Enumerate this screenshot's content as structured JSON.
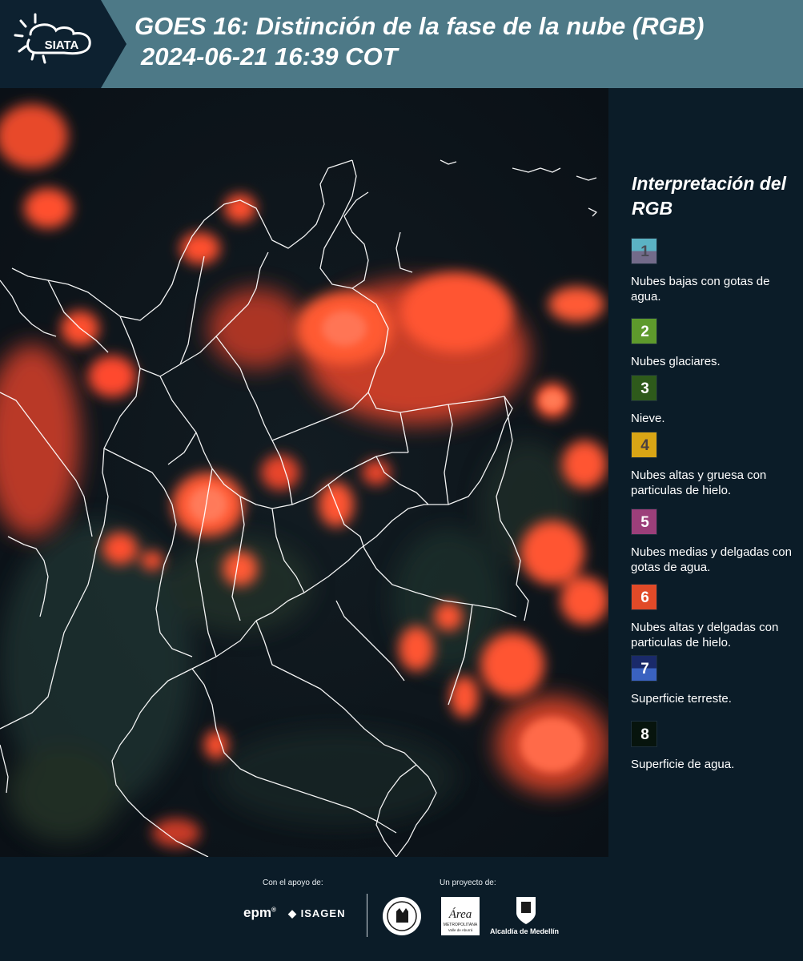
{
  "header": {
    "logo_text": "SIATA",
    "title_line1": "GOES 16: Distinción de la fase de la nube (RGB)",
    "title_line2": "2024-06-21 16:39 COT"
  },
  "legend": {
    "title": "Interpretación del RGB",
    "items": [
      {
        "num": "1",
        "desc": "Nubes bajas con gotas de agua.",
        "top_color": "#5bb2c4",
        "bottom_color": "#736b8a",
        "num_color": "#4a4a55"
      },
      {
        "num": "2",
        "desc": "Nubes glaciares.",
        "top_color": "#5e9a2c",
        "bottom_color": "#5e9a2c",
        "num_color": "#ffffff"
      },
      {
        "num": "3",
        "desc": "Nieve.",
        "top_color": "#2e5a1b",
        "bottom_color": "#2e5a1b",
        "num_color": "#ffffff"
      },
      {
        "num": "4",
        "desc": "Nubes altas y gruesa con particulas de hielo.",
        "top_color": "#d9a515",
        "bottom_color": "#d9a515",
        "num_color": "#4a4040"
      },
      {
        "num": "5",
        "desc": "Nubes medias y delgadas con gotas de agua.",
        "top_color": "#9c3f7a",
        "bottom_color": "#9c3f7a",
        "num_color": "#ffffff"
      },
      {
        "num": "6",
        "desc": "Nubes altas y delgadas con particulas de hielo.",
        "top_color": "#e14a28",
        "bottom_color": "#e14a28",
        "num_color": "#ffffff"
      },
      {
        "num": "7",
        "desc": "Superficie terreste.",
        "top_color": "#1a2a6a",
        "bottom_color": "#3a62c0",
        "num_color": "#ffffff"
      },
      {
        "num": "8",
        "desc": "Superficie de agua.",
        "top_color": "#07140d",
        "bottom_color": "#07140d",
        "num_color": "#ffffff"
      }
    ]
  },
  "footer": {
    "support_label": "Con el apoyo de:",
    "project_label": "Un proyecto de:",
    "sponsor_epm": "epm",
    "sponsor_isagen": "ISAGEN",
    "sponsor_area": "Área",
    "sponsor_area_sub": "METROPOLITANA",
    "sponsor_area_sub2": "Valle de Aburrá",
    "sponsor_alcaldia": "Alcaldía de Medellín"
  },
  "colors": {
    "header_bg": "#4d7987",
    "panel_bg": "#0b1c28",
    "cloud_ice": "#ff4a2a",
    "border_line": "#ffffff"
  }
}
